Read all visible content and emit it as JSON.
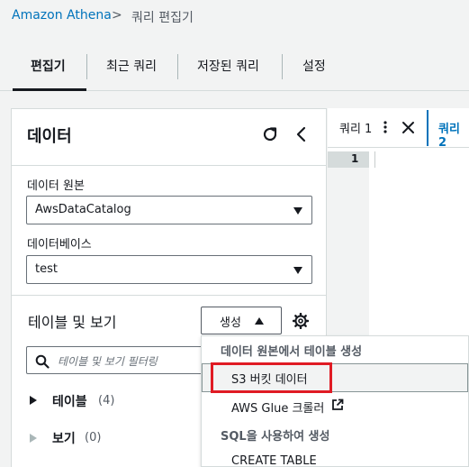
{
  "breadcrumb": {
    "root": "Amazon Athena",
    "separator": ">",
    "current": "쿼리 편집기"
  },
  "tabs": [
    {
      "label": "편집기",
      "active": true
    },
    {
      "label": "최근 쿼리",
      "active": false
    },
    {
      "label": "저장된 쿼리",
      "active": false
    },
    {
      "label": "설정",
      "active": false
    }
  ],
  "data_panel": {
    "title": "데이터",
    "source_label": "데이터 원본",
    "source_value": "AwsDataCatalog",
    "database_label": "데이터베이스",
    "database_value": "test",
    "tables_views_title": "테이블 및 보기",
    "create_button": "생성",
    "filter_placeholder": "테이블 및 보기 필터링",
    "tree": [
      {
        "label": "테이블",
        "count": "(4)"
      },
      {
        "label": "보기",
        "count": "(0)"
      }
    ]
  },
  "query_editor": {
    "tabs": [
      {
        "label": "쿼리 1"
      },
      {
        "label": "쿼리 2"
      }
    ],
    "line_number": "1"
  },
  "create_menu": {
    "group1": "데이터 원본에서 테이블 생성",
    "items1": [
      "S3 버킷 데이터",
      "AWS Glue 크롤러"
    ],
    "group2": "SQL을 사용하여 생성",
    "items2": [
      "CREATE TABLE"
    ]
  },
  "colors": {
    "link": "#0073bb",
    "highlight_box": "#e01b24",
    "text": "#16191f"
  }
}
